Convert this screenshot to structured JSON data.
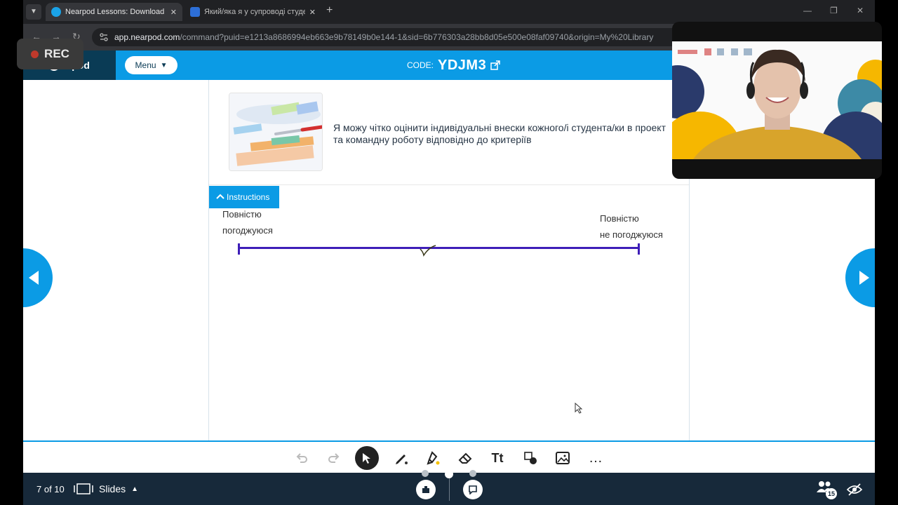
{
  "browser": {
    "tabs": [
      {
        "title": "Nearpod Lessons: Download re",
        "active": true
      },
      {
        "title": "Який/яка я у супроводі студен",
        "active": false
      }
    ],
    "url_host": "app.nearpod.com",
    "url_path": "/command?puid=e1213a8686994eb663e9b78149b0e144-1&sid=6b776303a28bb8d05e500e08faf09740&origin=My%20Library"
  },
  "recording": {
    "label": "REC"
  },
  "header": {
    "logo_text": "arpod",
    "menu_label": "Menu",
    "code_label": "CODE:",
    "code_value": "YDJM3"
  },
  "question": {
    "text": "Я можу чітко оцінити індивідуальні внески кожного/і студента/ки в проект та командну роботу відповідно до критеріїв"
  },
  "instructions_label": "Instructions",
  "scale": {
    "left_line1": "Повністю",
    "left_line2": "погоджуюся",
    "right_line1": "Повністю",
    "right_line2": "не погоджуюся"
  },
  "footer": {
    "slide_position": "7 of 10",
    "slides_label": "Slides",
    "participants_count": "15"
  },
  "colors": {
    "nearpod_blue": "#0b9be5",
    "scale_purple": "#3e1eb8",
    "footer_navy": "#17293a"
  }
}
